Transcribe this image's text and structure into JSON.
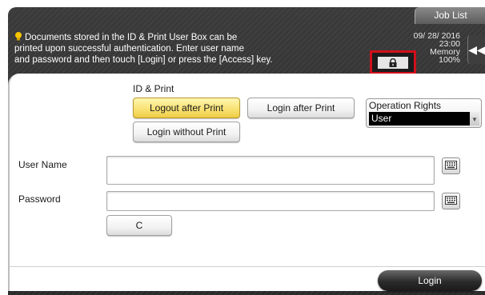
{
  "header": {
    "job_list_label": "Job List",
    "message_lines": [
      "Documents stored in the ID & Print User Box can be",
      "printed upon successful authentication. Enter user name",
      "and password and then touch [Login] or press the [Access] key."
    ],
    "date": "09/ 28/ 2016",
    "time": "23:00",
    "memory_label": "Memory",
    "memory_value": "100%",
    "icons": {
      "message": "bulb-icon",
      "lock": "lock-icon",
      "back": "double-left-arrow-icon"
    }
  },
  "id_print": {
    "title": "ID & Print",
    "logout_after_print": "Logout after Print",
    "login_after_print": "Login after Print",
    "login_without_print": "Login without Print",
    "selected": "Logout after Print"
  },
  "operation_rights": {
    "label": "Operation Rights",
    "value": "User"
  },
  "form": {
    "user_name_label": "User Name",
    "user_name_value": "",
    "password_label": "Password",
    "password_value": "",
    "clear_label": "C",
    "keyboard_icon": "keyboard-icon"
  },
  "footer": {
    "login_label": "Login"
  },
  "colors": {
    "selected_button": "#f8e070",
    "highlight_border": "#d0101a",
    "header_background": "#2f2f2f"
  }
}
